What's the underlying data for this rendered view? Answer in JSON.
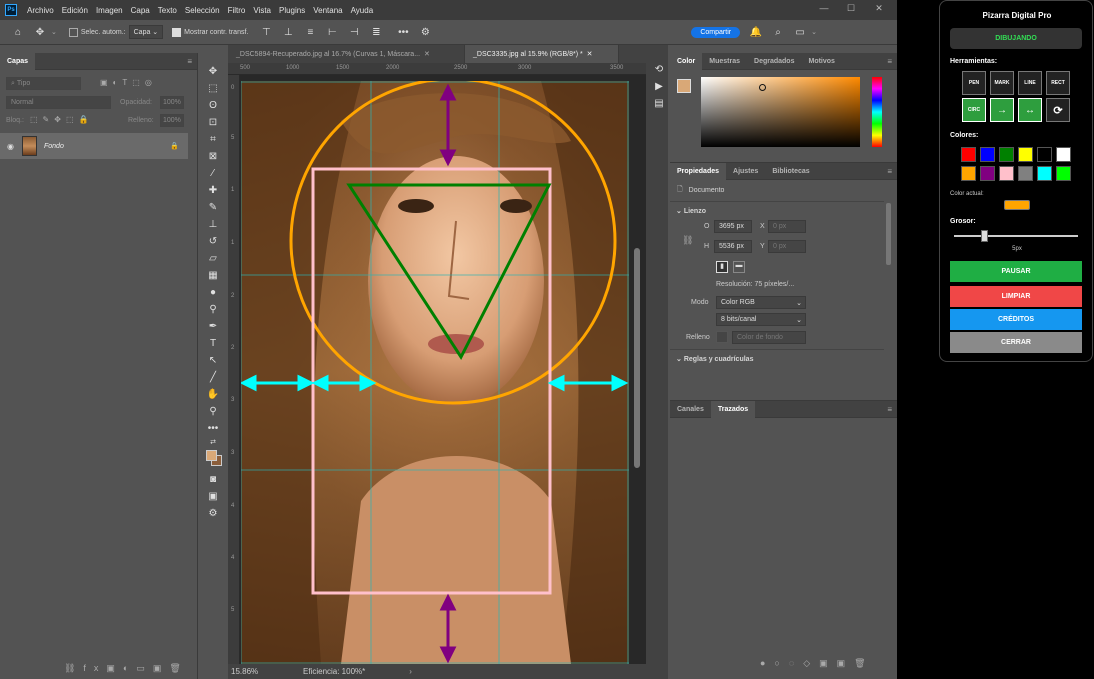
{
  "app": {
    "logo": "Ps",
    "menu": [
      "Archivo",
      "Edición",
      "Imagen",
      "Capa",
      "Texto",
      "Selección",
      "Filtro",
      "Vista",
      "Plugins",
      "Ventana",
      "Ayuda"
    ]
  },
  "options": {
    "auto_select_label": "Selec. autom.:",
    "auto_select_value": "Capa",
    "transform_label": "Mostrar contr. transf.",
    "more": "•••",
    "share_label": "Compartir"
  },
  "layers_panel": {
    "tab": "Capas",
    "search_placeholder": "Tipo",
    "blend_mode": "Normal",
    "opacity_label": "Opacidad:",
    "opacity_value": "100%",
    "lock_label": "Bloq.:",
    "fill_label": "Relleno:",
    "fill_value": "100%",
    "layer_name": "Fondo"
  },
  "documents": {
    "tabs": [
      {
        "label": "_DSC5894-Recuperado.jpg al 16.7% (Curvas 1, Máscara..."
      },
      {
        "label": "_DSC3335.jpg al 15.9% (RGB/8*) *"
      }
    ],
    "ruler_marks": [
      "500",
      "1000",
      "1500",
      "2000",
      "2500",
      "3000",
      "3500"
    ],
    "v_ruler_marks": [
      "0",
      "5",
      "1",
      "1",
      "2",
      "2",
      "3",
      "3",
      "4",
      "4",
      "5"
    ]
  },
  "status": {
    "zoom": "15.86%",
    "efficiency": "Eficiencia: 100%*"
  },
  "color_panel": {
    "tabs": [
      "Color",
      "Muestras",
      "Degradados",
      "Motivos"
    ],
    "foreground": "#d9a877"
  },
  "properties_panel": {
    "tabs": [
      "Propiedades",
      "Ajustes",
      "Bibliotecas"
    ],
    "doc_label": "Documento",
    "canvas_section": "Lienzo",
    "width_label": "O",
    "width_value": "3695 px",
    "height_label": "H",
    "height_value": "5536 px",
    "x_label": "X",
    "x_value": "0 px",
    "y_label": "Y",
    "y_value": "0 px",
    "resolution": "Resolución: 75 píxeles/...",
    "mode_label": "Modo",
    "mode_value": "Color RGB",
    "depth_value": "8 bits/canal",
    "fill_label": "Relleno",
    "fill_value": "Color de fondo",
    "rulers_section": "Reglas y cuadrículas"
  },
  "channels_panel": {
    "tabs": [
      "Canales",
      "Trazados"
    ]
  },
  "board": {
    "title": "Pizarra Digital Pro",
    "status": "DIBUJANDO",
    "tools_label": "Herramientas:",
    "tools": [
      "PEN",
      "MARK",
      "LINE",
      "RECT",
      "CIRC",
      "→",
      "↔",
      "⟳"
    ],
    "colors_label": "Colores:",
    "colors": [
      "#ff0000",
      "#0000ff",
      "#008000",
      "#ffff00",
      "#000000",
      "#ffffff",
      "#ffa500",
      "#800080",
      "#ffc0cb",
      "#808080",
      "#00ffff",
      "#00ff00"
    ],
    "current_color_label": "Color actual:",
    "current_color": "#ffa500",
    "thickness_label": "Grosor:",
    "thickness_value": "5px",
    "thickness_level": 0.25,
    "buttons": {
      "pause": "PAUSAR",
      "clear": "LIMPIAR",
      "credits": "CRÉDITOS",
      "close": "CERRAR"
    }
  }
}
